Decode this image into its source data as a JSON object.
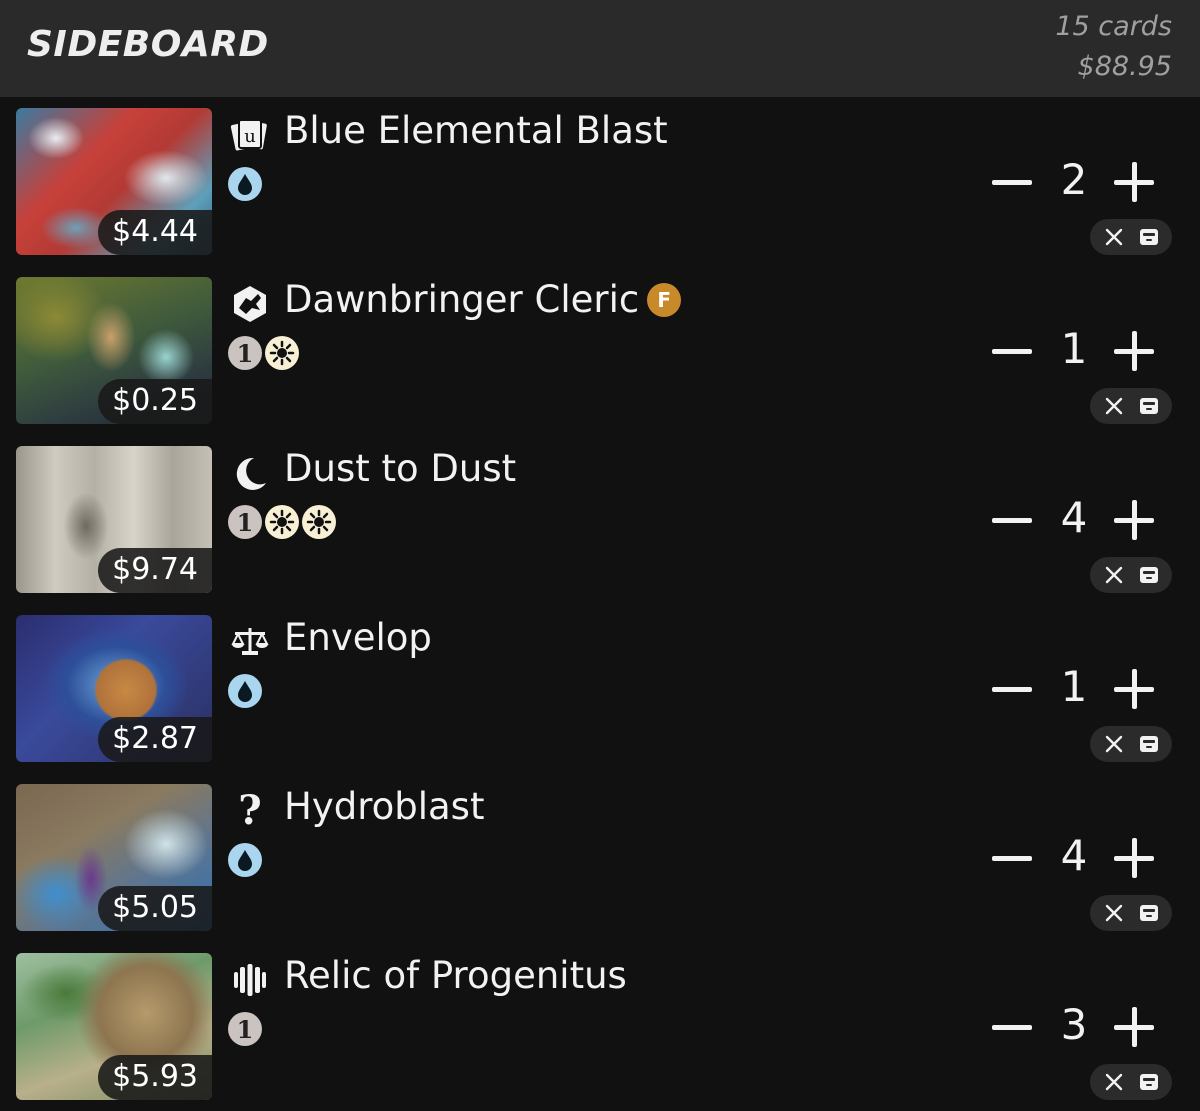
{
  "header": {
    "title": "SIDEBOARD",
    "count_label": "15 cards",
    "total_price": "$88.95"
  },
  "cards": [
    {
      "name": "Blue Elemental Blast",
      "price": "$4.44",
      "quantity": "2",
      "type_icon": "instant-card-icon",
      "mana": [
        "U"
      ],
      "foil": false
    },
    {
      "name": "Dawnbringer Cleric",
      "price": "$0.25",
      "quantity": "1",
      "type_icon": "creature-icon",
      "mana": [
        "1",
        "W"
      ],
      "foil": true,
      "foil_label": "F"
    },
    {
      "name": "Dust to Dust",
      "price": "$9.74",
      "quantity": "4",
      "type_icon": "moon-icon",
      "mana": [
        "1",
        "W",
        "W"
      ],
      "foil": false
    },
    {
      "name": "Envelop",
      "price": "$2.87",
      "quantity": "1",
      "type_icon": "scales-icon",
      "mana": [
        "U"
      ],
      "foil": false
    },
    {
      "name": "Hydroblast",
      "price": "$5.05",
      "quantity": "4",
      "type_icon": "question-icon",
      "mana": [
        "U"
      ],
      "foil": false
    },
    {
      "name": "Relic of Progenitus",
      "price": "$5.93",
      "quantity": "3",
      "type_icon": "relic-icon",
      "mana": [
        "1"
      ],
      "foil": false
    }
  ],
  "colors": {
    "header_bg": "#2a2a2a",
    "body_bg": "#111111",
    "blue_mana": "#a9d6ee",
    "white_mana": "#f7f0d5",
    "generic_mana": "#cbc3c0",
    "foil_badge": "#c8892a"
  }
}
